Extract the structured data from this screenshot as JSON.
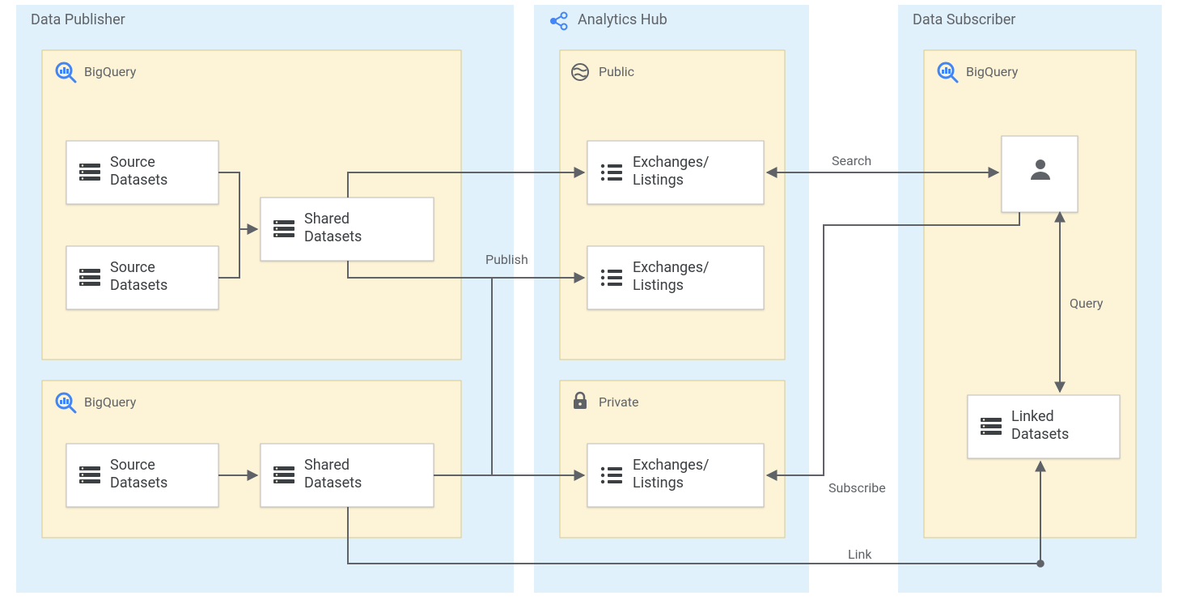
{
  "columns": {
    "publisher": {
      "title": "Data Publisher"
    },
    "hub": {
      "title": "Analytics Hub"
    },
    "subscriber": {
      "title": "Data Subscriber"
    }
  },
  "sections": {
    "pub_bq_top": {
      "title": "BigQuery"
    },
    "pub_bq_bottom": {
      "title": "BigQuery"
    },
    "hub_public": {
      "title": "Public"
    },
    "hub_private": {
      "title": "Private"
    },
    "sub_bq": {
      "title": "BigQuery"
    }
  },
  "nodes": {
    "source_ds_1": {
      "line1": "Source",
      "line2": "Datasets"
    },
    "source_ds_2": {
      "line1": "Source",
      "line2": "Datasets"
    },
    "shared_ds_1": {
      "line1": "Shared",
      "line2": "Datasets"
    },
    "source_ds_3": {
      "line1": "Source",
      "line2": "Datasets"
    },
    "shared_ds_2": {
      "line1": "Shared",
      "line2": "Datasets"
    },
    "exch_1": {
      "line1": "Exchanges/",
      "line2": "Listings"
    },
    "exch_2": {
      "line1": "Exchanges/",
      "line2": "Listings"
    },
    "exch_3": {
      "line1": "Exchanges/",
      "line2": "Listings"
    },
    "linked_ds": {
      "line1": "Linked",
      "line2": "Datasets"
    }
  },
  "edges": {
    "publish": {
      "label": "Publish"
    },
    "search": {
      "label": "Search"
    },
    "query": {
      "label": "Query"
    },
    "subscribe": {
      "label": "Subscribe"
    },
    "link": {
      "label": "Link"
    }
  }
}
